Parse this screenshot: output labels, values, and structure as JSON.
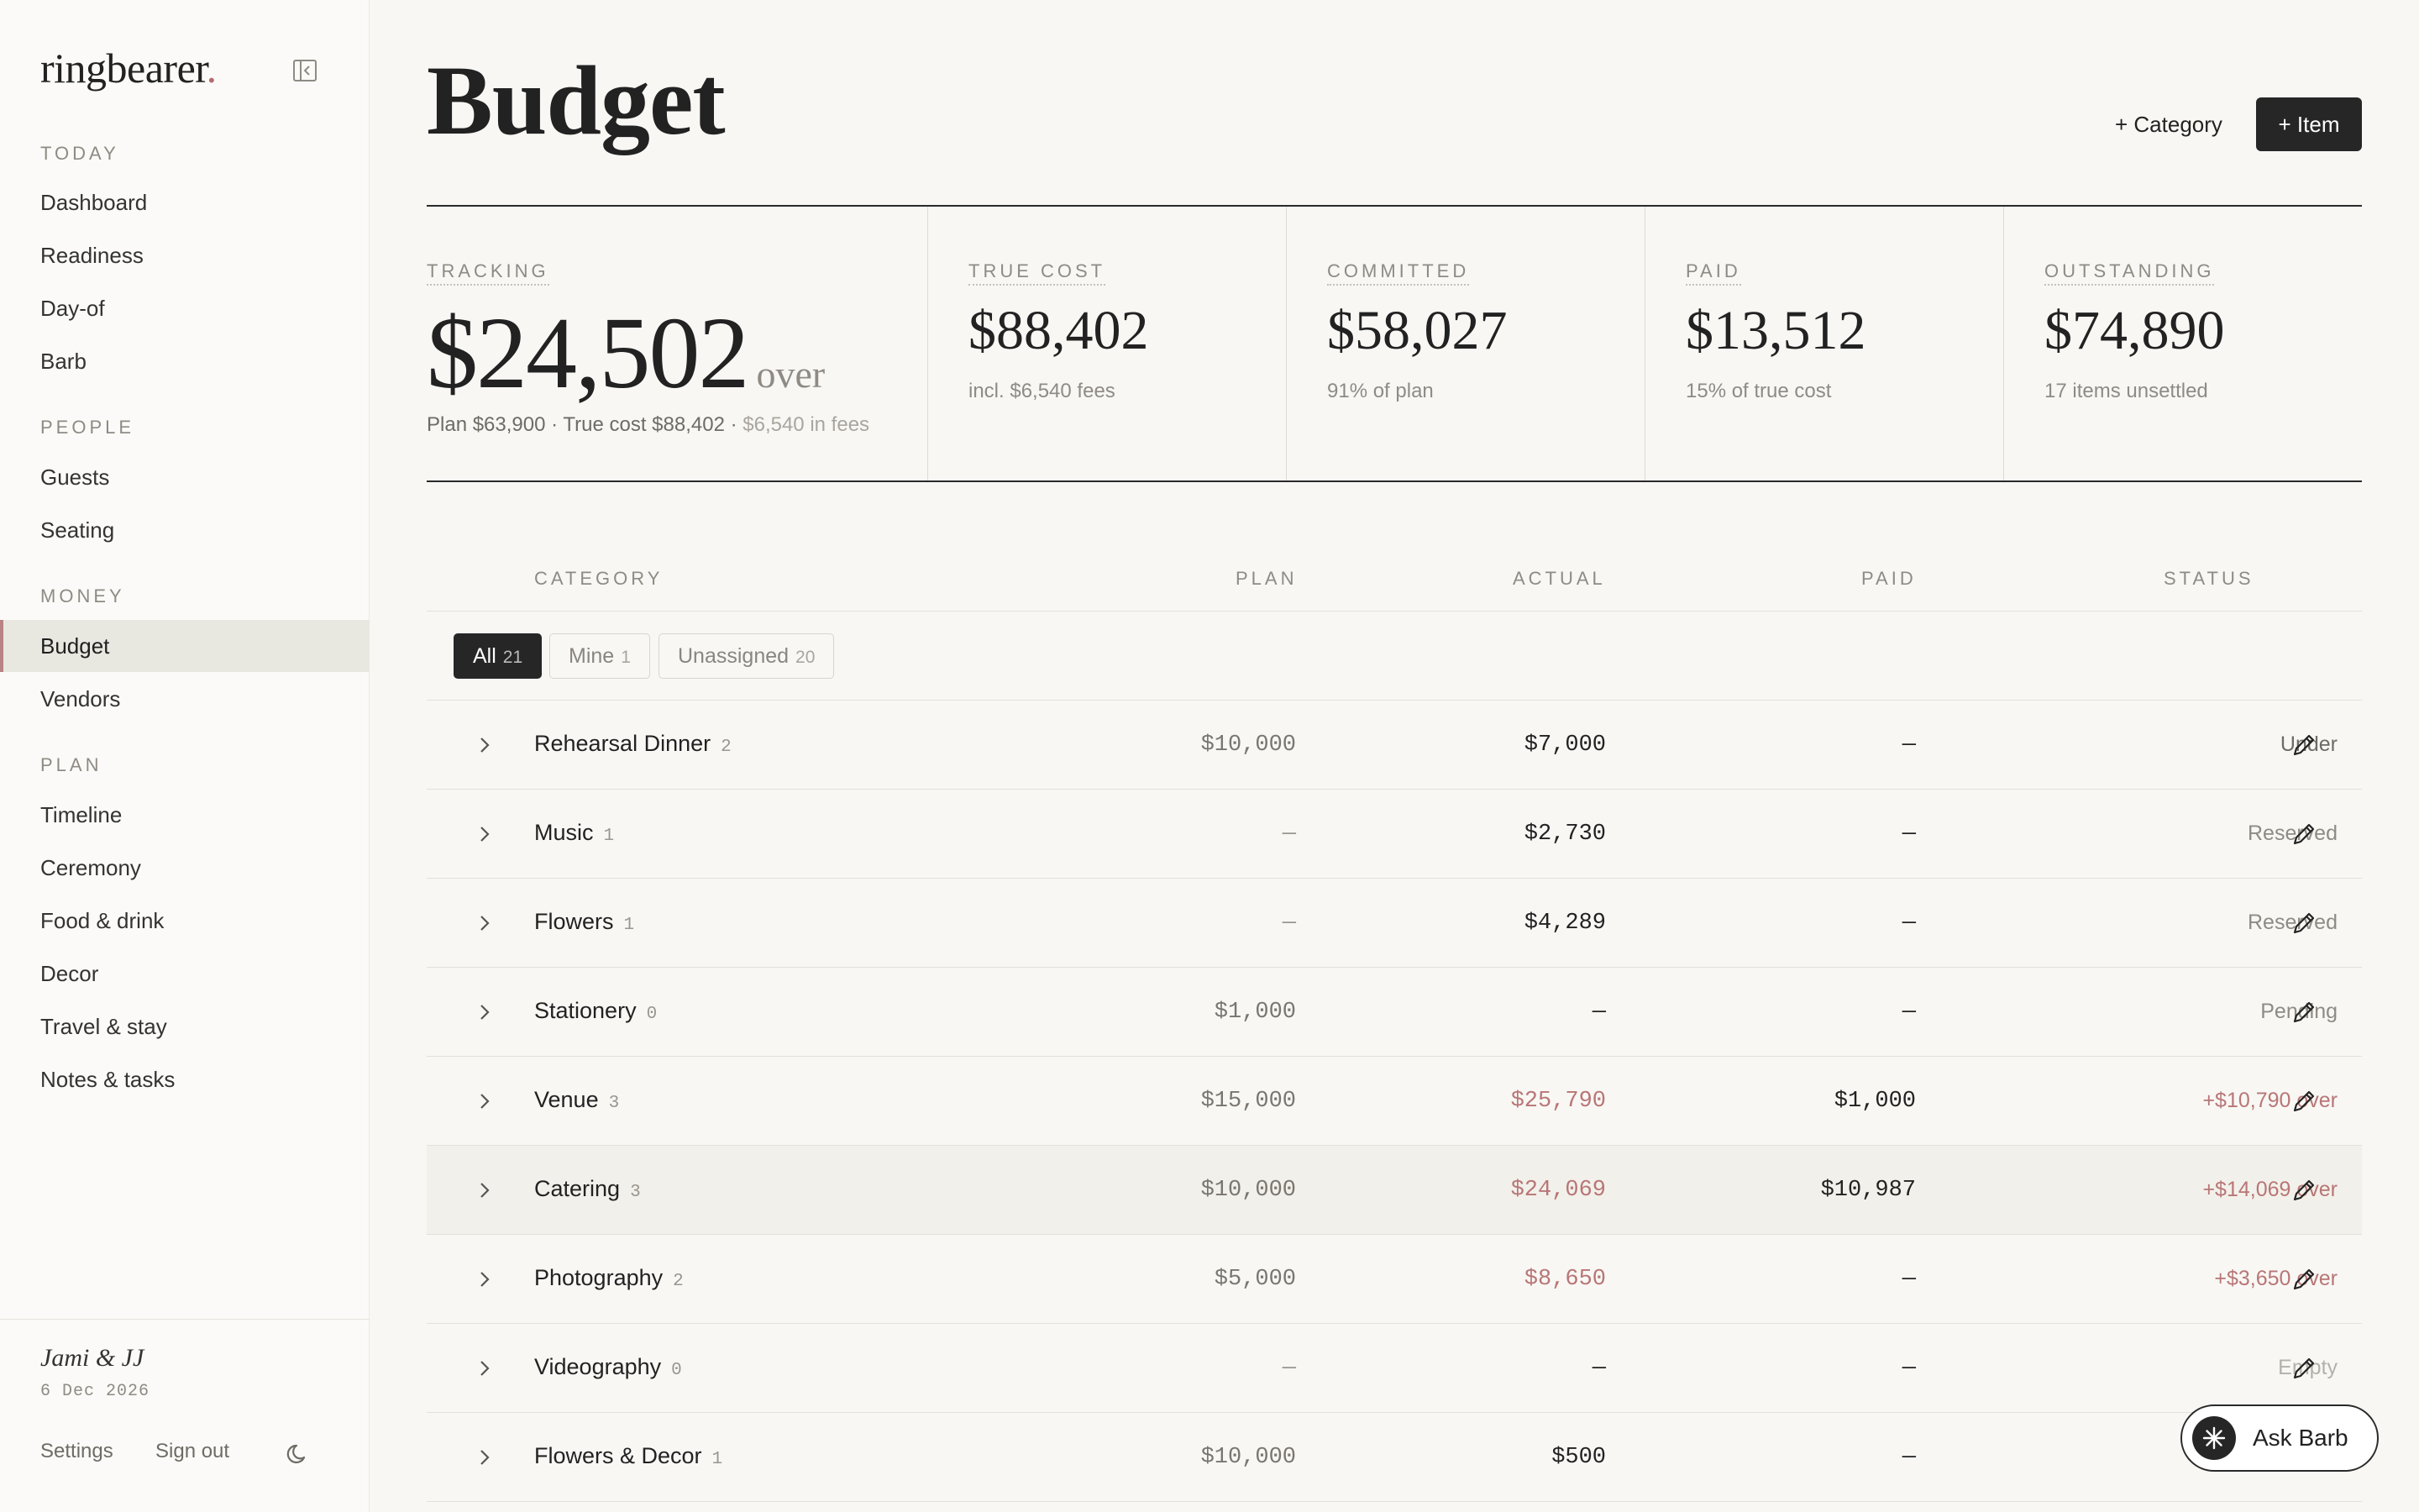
{
  "app": {
    "name": "ringbearer",
    "name_dot": "."
  },
  "sidebar": {
    "sections": [
      {
        "label": "TODAY",
        "items": [
          "Dashboard",
          "Readiness",
          "Day-of",
          "Barb"
        ]
      },
      {
        "label": "PEOPLE",
        "items": [
          "Guests",
          "Seating"
        ]
      },
      {
        "label": "MONEY",
        "items": [
          "Budget",
          "Vendors"
        ]
      },
      {
        "label": "PLAN",
        "items": [
          "Timeline",
          "Ceremony",
          "Food & drink",
          "Decor",
          "Travel & stay",
          "Notes & tasks"
        ]
      }
    ],
    "active_item": "Budget",
    "couple": "Jami & JJ",
    "wedding_date": "6 Dec 2026",
    "settings_label": "Settings",
    "signout_label": "Sign out"
  },
  "header": {
    "title": "Budget",
    "add_category_label": "+ Category",
    "add_item_label": "+ Item"
  },
  "stats": {
    "tracking": {
      "label": "TRACKING",
      "value": "$24,502",
      "value_suffix": "over",
      "sub_main": "Plan $63,900 · True cost $88,402 ·",
      "sub_light": "$6,540 in fees"
    },
    "true_cost": {
      "label": "TRUE COST",
      "value": "$88,402",
      "sub": "incl. $6,540 fees"
    },
    "committed": {
      "label": "COMMITTED",
      "value": "$58,027",
      "sub": "91% of plan"
    },
    "paid": {
      "label": "PAID",
      "value": "$13,512",
      "sub": "15% of true cost"
    },
    "outstanding": {
      "label": "OUTSTANDING",
      "value": "$74,890",
      "sub": "17 items unsettled"
    }
  },
  "table": {
    "columns": {
      "category": "CATEGORY",
      "plan": "PLAN",
      "actual": "ACTUAL",
      "paid": "PAID",
      "status": "STATUS"
    },
    "filters": [
      {
        "label": "All",
        "count": "21"
      },
      {
        "label": "Mine",
        "count": "1"
      },
      {
        "label": "Unassigned",
        "count": "20"
      }
    ],
    "active_filter": "All",
    "rows": [
      {
        "name": "Rehearsal Dinner",
        "count": "2",
        "plan": "$10,000",
        "actual": "$7,000",
        "paid": "—",
        "status": "Under"
      },
      {
        "name": "Music",
        "count": "1",
        "plan": "—",
        "actual": "$2,730",
        "paid": "—",
        "status": "Reserved"
      },
      {
        "name": "Flowers",
        "count": "1",
        "plan": "—",
        "actual": "$4,289",
        "paid": "—",
        "status": "Reserved"
      },
      {
        "name": "Stationery",
        "count": "0",
        "plan": "$1,000",
        "actual": "—",
        "paid": "—",
        "status": "Pending"
      },
      {
        "name": "Venue",
        "count": "3",
        "plan": "$15,000",
        "actual": "$25,790",
        "paid": "$1,000",
        "status": "+$10,790 over"
      },
      {
        "name": "Catering",
        "count": "3",
        "plan": "$10,000",
        "actual": "$24,069",
        "paid": "$10,987",
        "status": "+$14,069 over"
      },
      {
        "name": "Photography",
        "count": "2",
        "plan": "$5,000",
        "actual": "$8,650",
        "paid": "—",
        "status": "+$3,650 over"
      },
      {
        "name": "Videography",
        "count": "0",
        "plan": "—",
        "actual": "—",
        "paid": "—",
        "status": "Empty"
      },
      {
        "name": "Flowers & Decor",
        "count": "1",
        "plan": "$10,000",
        "actual": "$500",
        "paid": "—",
        "status": ""
      }
    ]
  },
  "assistant": {
    "label": "Ask Barb"
  },
  "icons": {
    "collapse": "sidebar-collapse-icon",
    "theme": "moon-icon",
    "row_expand": "chevron-right-icon",
    "row_edit": "pencil-icon",
    "assistant": "sparkle-icon"
  },
  "colors": {
    "accent_over": "#b87676",
    "active_nav_border": "#b88383",
    "primary_button": "#262626",
    "background": "#f8f7f4"
  }
}
